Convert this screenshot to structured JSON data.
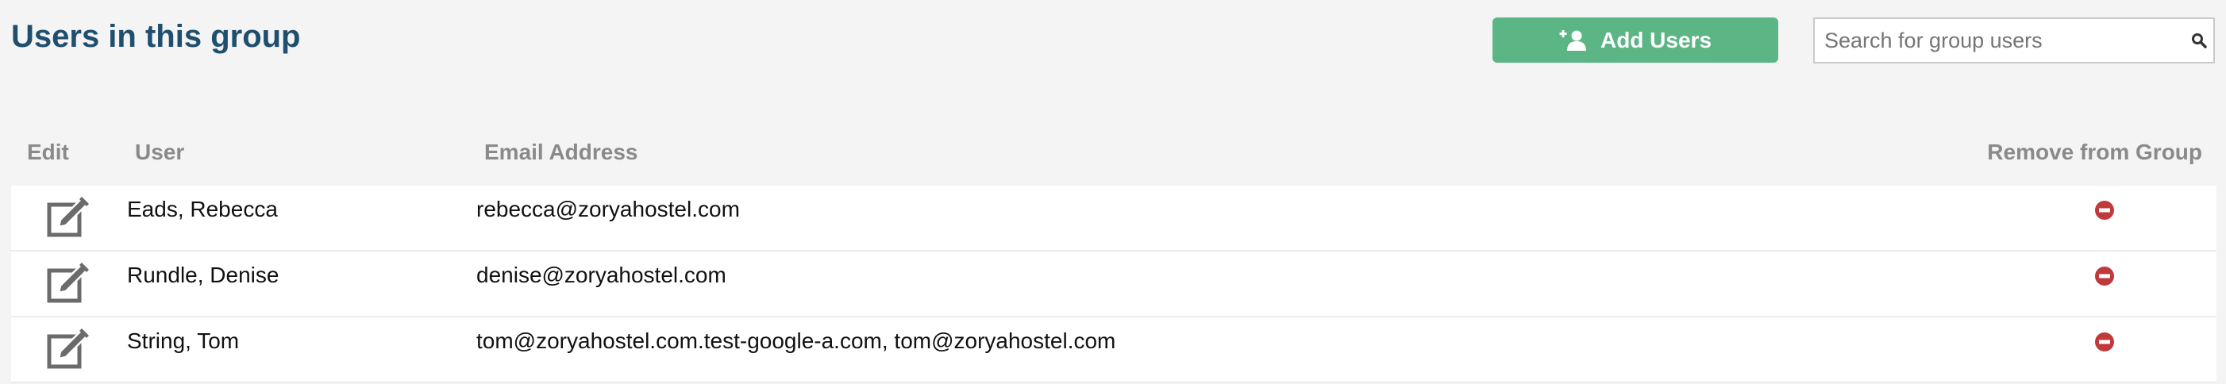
{
  "page": {
    "title": "Users in this group"
  },
  "toolbar": {
    "add_label": "Add Users",
    "add_icon": "add-user-icon",
    "search_placeholder": "Search for group users",
    "search_value": "",
    "search_icon": "search-icon"
  },
  "table": {
    "headers": {
      "edit": "Edit",
      "user": "User",
      "email": "Email Address",
      "remove": "Remove from Group"
    },
    "rows": [
      {
        "user": "Eads, Rebecca",
        "email": "rebecca@zoryahostel.com"
      },
      {
        "user": "Rundle, Denise",
        "email": "denise@zoryahostel.com"
      },
      {
        "user": "String, Tom",
        "email": "tom@zoryahostel.com.test-google-a.com, tom@zoryahostel.com"
      }
    ]
  },
  "colors": {
    "title": "#1f4e6e",
    "add_button": "#5cb585",
    "remove_icon": "#c0393b",
    "header_text": "#8a8a8a"
  }
}
